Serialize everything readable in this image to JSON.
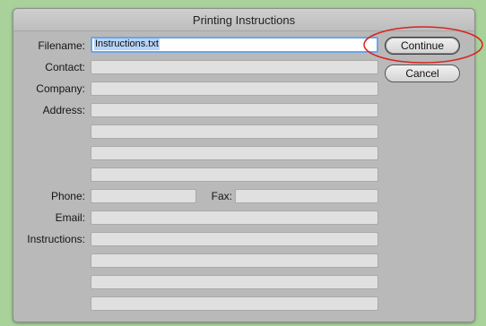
{
  "dialog": {
    "title": "Printing Instructions"
  },
  "fields": {
    "filename_label": "Filename:",
    "filename_value": "Instructions.txt",
    "contact_label": "Contact:",
    "company_label": "Company:",
    "address_label": "Address:",
    "phone_label": "Phone:",
    "fax_label": "Fax:",
    "email_label": "Email:",
    "instructions_label": "Instructions:"
  },
  "buttons": {
    "continue": "Continue",
    "cancel": "Cancel"
  },
  "colors": {
    "background": "#a9d29a",
    "dialog": "#b9b9b9",
    "focus_ring": "#6aa6e7",
    "annotation": "#d9231f"
  }
}
